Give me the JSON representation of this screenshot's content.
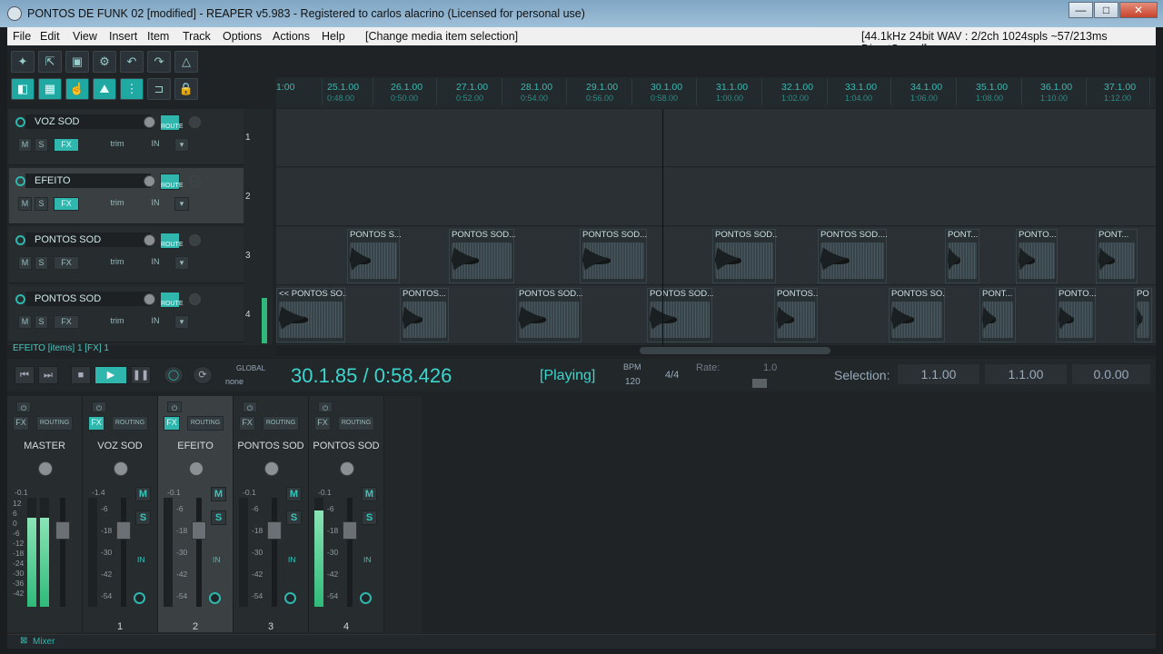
{
  "window": {
    "title": "PONTOS DE FUNK 02 [modified] - REAPER v5.983 - Registered to carlos alacrino (Licensed for personal use)",
    "min": "—",
    "max": "□",
    "close": "✕"
  },
  "menu": {
    "items": [
      "File",
      "Edit",
      "View",
      "Insert",
      "Item",
      "Track",
      "Options",
      "Actions",
      "Help"
    ],
    "action": "[Change media item selection]",
    "status": "[44.1kHz 24bit WAV : 2/2ch 1024spls ~57/213ms DirectSound]"
  },
  "ruler": {
    "marks": [
      {
        "m": "1:00",
        "t": ""
      },
      {
        "m": "25.1.00",
        "t": "0:48.00"
      },
      {
        "m": "26.1.00",
        "t": "0:50.00"
      },
      {
        "m": "27.1.00",
        "t": "0:52.00"
      },
      {
        "m": "28.1.00",
        "t": "0:54.00"
      },
      {
        "m": "29.1.00",
        "t": "0:56.00"
      },
      {
        "m": "30.1.00",
        "t": "0:58.00"
      },
      {
        "m": "31.1.00",
        "t": "1:00.00"
      },
      {
        "m": "32.1.00",
        "t": "1:02.00"
      },
      {
        "m": "33.1.00",
        "t": "1:04.00"
      },
      {
        "m": "34.1.00",
        "t": "1:06.00"
      },
      {
        "m": "35.1.00",
        "t": "1:08.00"
      },
      {
        "m": "36.1.00",
        "t": "1:10.00"
      },
      {
        "m": "37.1.00",
        "t": "1:12.00"
      }
    ]
  },
  "tracks": [
    {
      "name": "VOZ SOD",
      "num": "1"
    },
    {
      "name": "EFEITO",
      "num": "2"
    },
    {
      "name": "PONTOS SOD",
      "num": "3"
    },
    {
      "name": "PONTOS SOD",
      "num": "4"
    }
  ],
  "track_labels": {
    "m": "M",
    "s": "S",
    "fx": "FX",
    "trim": "trim",
    "in": "IN",
    "route": "ROUTE"
  },
  "items_lane3": [
    "PONTOS S...",
    "PONTOS SOD....",
    "PONTOS SOD....",
    "PONTOS SOD....",
    "PONTOS SOD....",
    "PONT...",
    "PONTO...",
    "PONT..."
  ],
  "items_lane4": [
    "<< PONTOS SO...",
    "PONTOS...",
    "PONTOS SOD....",
    "PONTOS SOD....",
    "PONTOS...",
    "PONTOS SO...",
    "PONT...",
    "PONTO...",
    "PO"
  ],
  "status_line": "EFEITO [items] 1 [FX] 1",
  "transport": {
    "global": "GLOBAL",
    "global_val": "none",
    "time": "30.1.85 / 0:58.426",
    "state": "[Playing]",
    "bpm_label": "BPM",
    "bpm": "120",
    "sig": "4/4",
    "rate_label": "Rate:",
    "rate": "1.0",
    "selection_label": "Selection:",
    "sel_start": "1.1.00",
    "sel_end": "1.1.00",
    "sel_len": "0.0.00"
  },
  "mixer": {
    "strips": [
      {
        "name": "MASTER",
        "num": "",
        "b1": "FX",
        "b2": "ROUTING",
        "b3": "MONO",
        "vol": "-0.1",
        "vol2": "-0.1"
      },
      {
        "name": "VOZ SOD",
        "num": "1",
        "b1": "FX",
        "b2": "ROUTING",
        "b3": "",
        "vol": "-1.4",
        "vol2": ""
      },
      {
        "name": "EFEITO",
        "num": "2",
        "b1": "FX",
        "b2": "ROUTING",
        "b3": "",
        "vol": "-0.1",
        "vol2": ""
      },
      {
        "name": "PONTOS SOD",
        "num": "3",
        "b1": "FX",
        "b2": "ROUTING",
        "b3": "",
        "vol": "-0.1",
        "vol2": ""
      },
      {
        "name": "PONTOS SOD",
        "num": "4",
        "b1": "FX",
        "b2": "ROUTING",
        "b3": "",
        "vol": "-0.1",
        "vol2": ""
      }
    ],
    "scale": [
      "-6",
      "-18",
      "-30",
      "-42",
      "-54"
    ],
    "master_scale": [
      "12",
      "6",
      "0",
      "-6",
      "-12",
      "-18",
      "-24",
      "-30",
      "-36",
      "-42"
    ],
    "tab": "Mixer"
  },
  "colors": {
    "accent": "#2fb7ae",
    "time": "#3dd6cf"
  }
}
